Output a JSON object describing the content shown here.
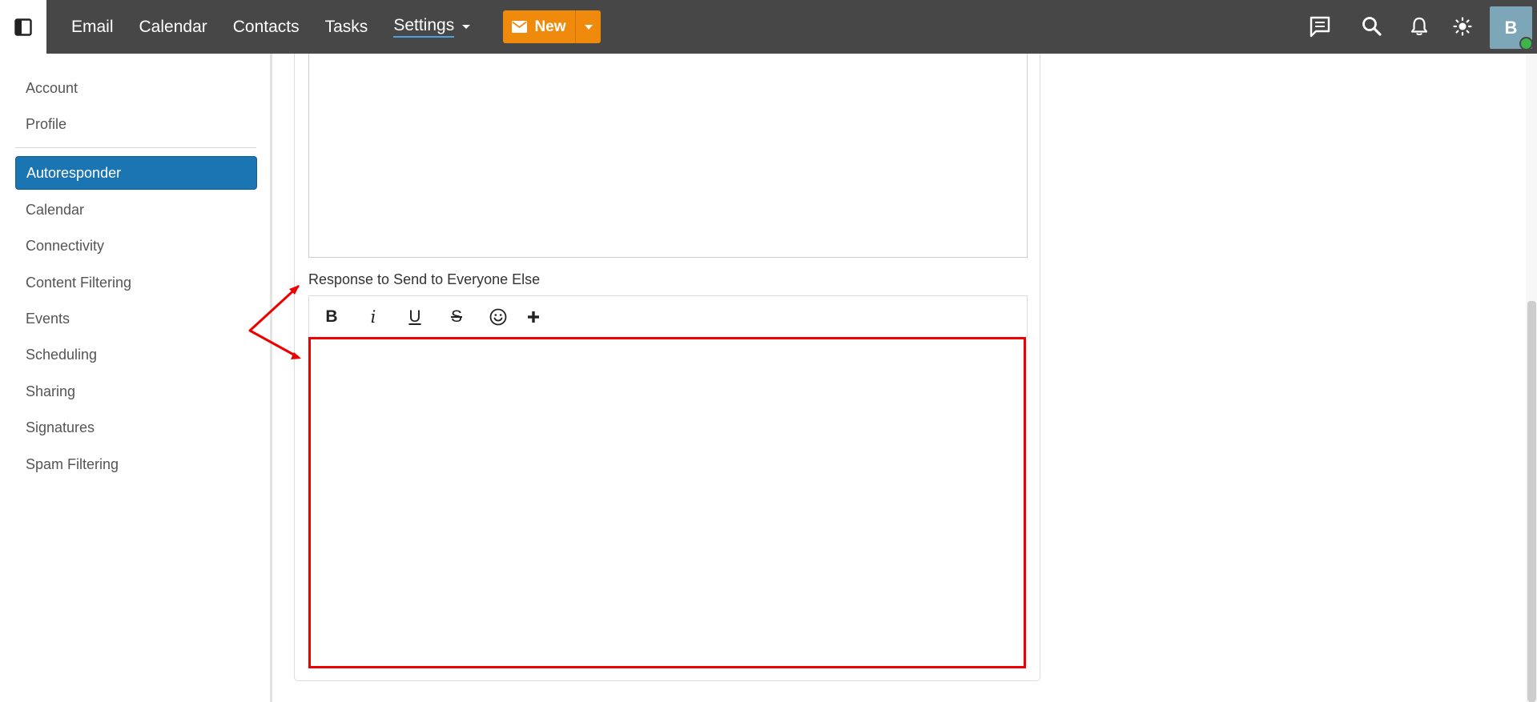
{
  "topbar": {
    "nav": [
      {
        "label": "Email",
        "active": false
      },
      {
        "label": "Calendar",
        "active": false
      },
      {
        "label": "Contacts",
        "active": false
      },
      {
        "label": "Tasks",
        "active": false
      },
      {
        "label": "Settings",
        "active": true
      }
    ],
    "new_button": {
      "label": "New"
    },
    "icons": [
      "sidebar-toggle-icon",
      "chat-icon",
      "search-icon",
      "bell-icon",
      "theme-sun-icon"
    ],
    "avatar_initial": "B",
    "colors": {
      "bar": "#474747",
      "accent": "#f08a0c",
      "presence": "#3cb54a"
    }
  },
  "sidebar": {
    "items": [
      {
        "label": "Account",
        "active": false
      },
      {
        "label": "Profile",
        "active": false
      },
      {
        "label": "Autoresponder",
        "active": true
      },
      {
        "label": "Calendar",
        "active": false
      },
      {
        "label": "Connectivity",
        "active": false
      },
      {
        "label": "Content Filtering",
        "active": false
      },
      {
        "label": "Events",
        "active": false
      },
      {
        "label": "Scheduling",
        "active": false
      },
      {
        "label": "Sharing",
        "active": false
      },
      {
        "label": "Signatures",
        "active": false
      },
      {
        "label": "Spam Filtering",
        "active": false
      }
    ],
    "active_color": "#1b75b2"
  },
  "main": {
    "response_label": "Response to Send to Everyone Else",
    "editor_value": "",
    "toolbar": {
      "bold": "B",
      "italic": "i",
      "underline": "U",
      "strikethrough": "S"
    },
    "highlight_color": "#ee0000"
  }
}
